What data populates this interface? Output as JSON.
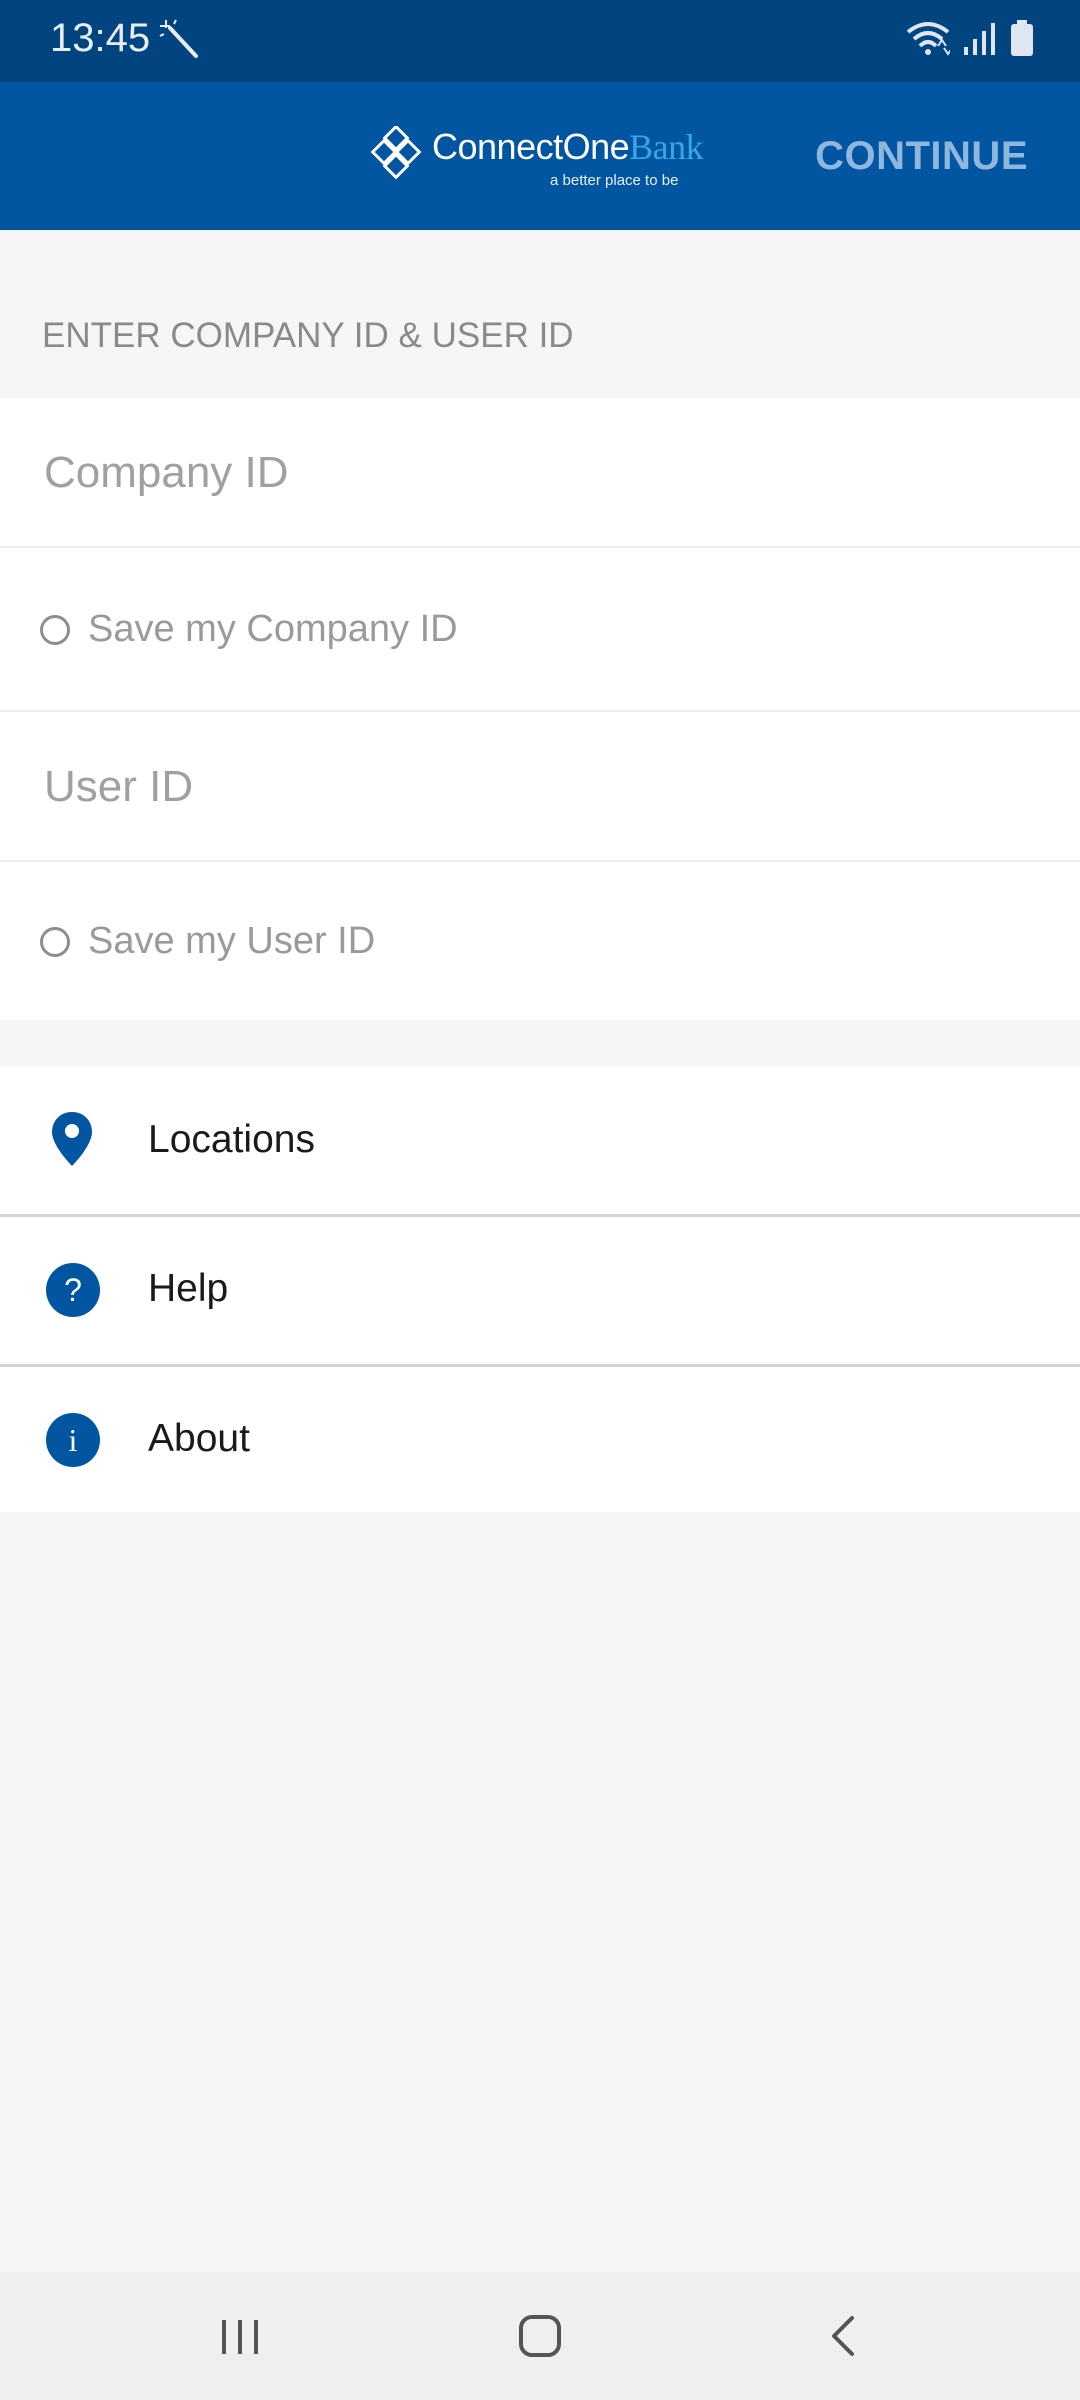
{
  "status_bar": {
    "time": "13:45",
    "icons": [
      "magic-wand-icon",
      "wifi-icon",
      "signal-icon",
      "battery-icon"
    ]
  },
  "header": {
    "logo": {
      "brand_main": "ConnectOne",
      "brand_accent": "Bank",
      "tagline": "a better place to be"
    },
    "continue_label": "CONTINUE"
  },
  "form": {
    "section_title": "ENTER COMPANY ID & USER ID",
    "company_id_placeholder": "Company ID",
    "company_id_value": "",
    "save_company_label": "Save my Company ID",
    "user_id_placeholder": "User ID",
    "user_id_value": "",
    "save_user_label": "Save my User ID"
  },
  "menu": {
    "items": [
      {
        "label": "Locations",
        "icon": "location-pin-icon"
      },
      {
        "label": "Help",
        "icon": "help-icon"
      },
      {
        "label": "About",
        "icon": "info-icon"
      }
    ]
  },
  "nav_bar": {
    "buttons": [
      "recent-apps",
      "home",
      "back"
    ]
  },
  "colors": {
    "status_bar": "#02447f",
    "app_bar": "#0155a1",
    "accent": "#0155a1",
    "continue_text": "#8fb6dd",
    "background": "#f6f6f6"
  }
}
